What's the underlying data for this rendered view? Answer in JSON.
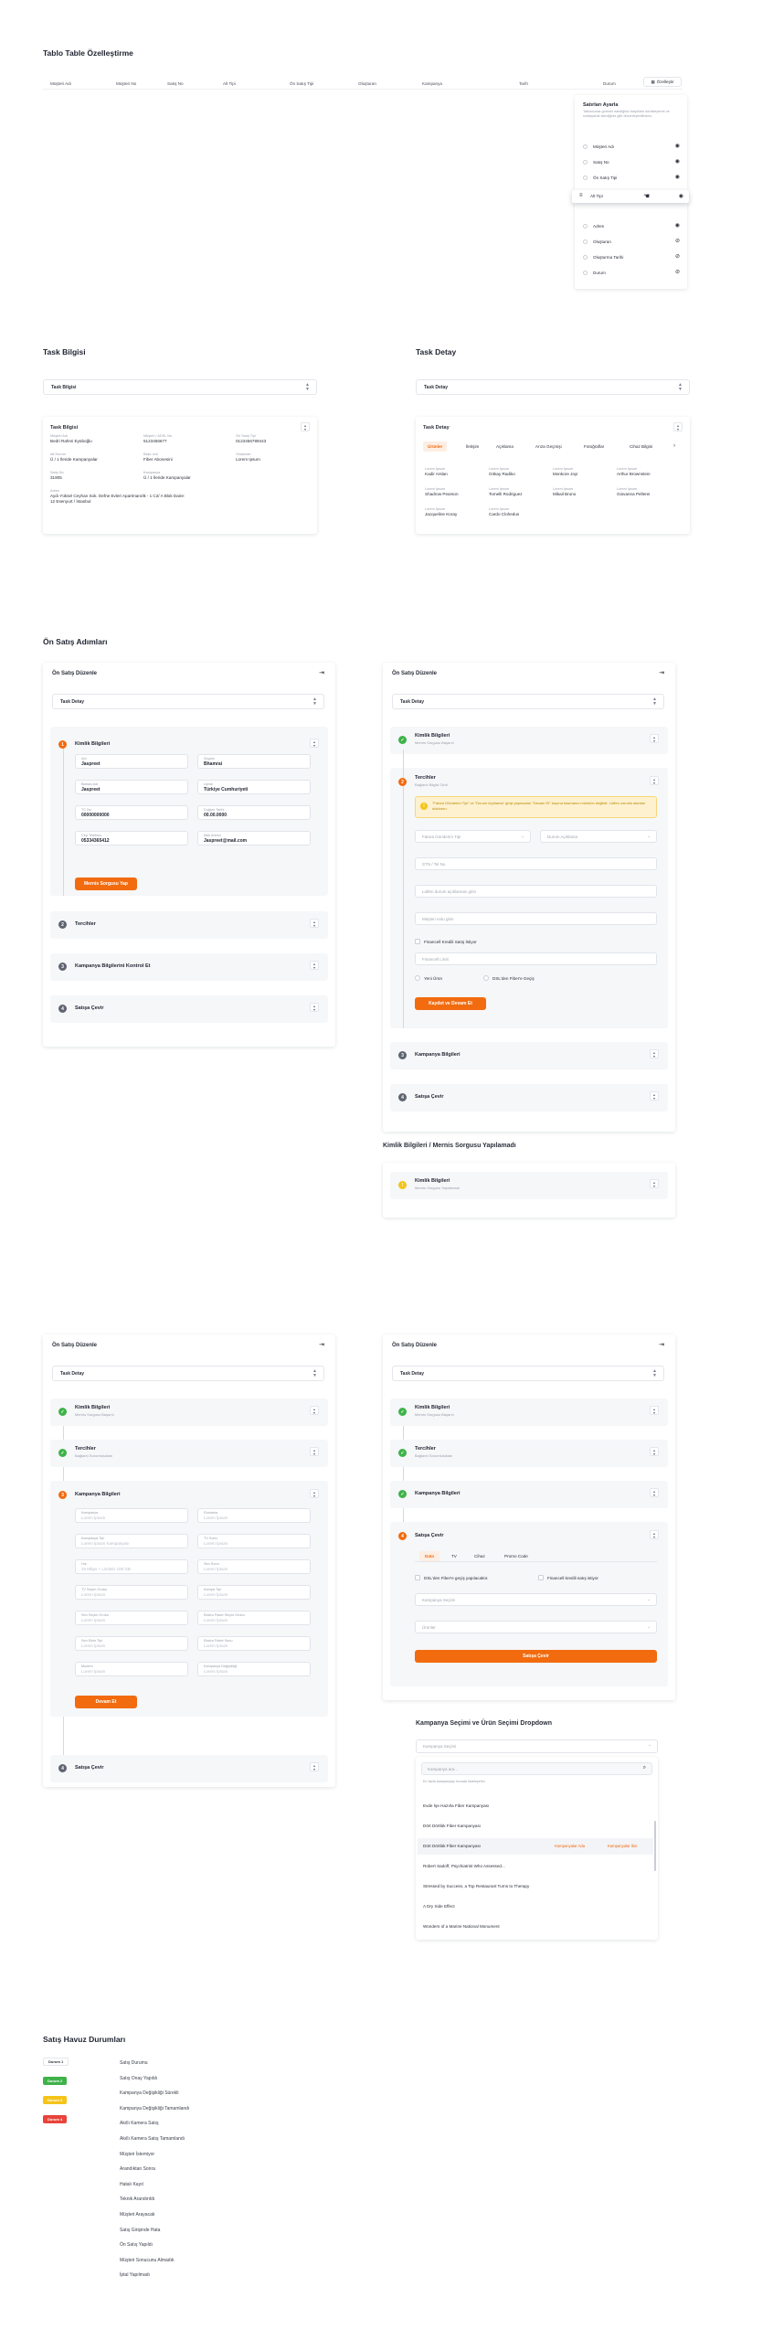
{
  "s1": {
    "title": "Tablo Table Özelleştirme",
    "columns": [
      "Müşteri Adı",
      "Müşteri No",
      "Satış No",
      "Alt Tipi",
      "Ön Satış Tipi",
      "Oluşturan",
      "Kampanya",
      "Tarih",
      "Durum"
    ],
    "customize_btn": "Özelleştir",
    "popup": {
      "title": "Satırları Ayarla",
      "desc": "Tablonuzda görmek istediğiniz başlıkları sürükleyerek ve sıralayarak istediğiniz gibi düzenleyebilirsiniz.",
      "rows": [
        "Müşteri Adı",
        "Satış No",
        "Ön Satış Tipi",
        "Müşteri No",
        "Adres",
        "Oluşturan",
        "Oluşturma Tarihi",
        "Durum"
      ],
      "dragging": "Alt Tipi"
    }
  },
  "s2": {
    "left_title": "Task Bilgisi",
    "right_title": "Task Detay",
    "left_select": "Task Bilgisi",
    "right_select": "Task Detay",
    "info_card_title": "Task Bilgisi",
    "info": [
      {
        "label": "Müşteri Adı",
        "value": "Bedri Rahmi Eyüboğlu"
      },
      {
        "label": "Müşteri / ADSL No",
        "value": "5123456677"
      },
      {
        "label": "Ön Satış Tipi",
        "value": "0123456789443"
      },
      {
        "label": "Alt Durum",
        "value": "Ü / 1 İleride Kampanyalar"
      },
      {
        "label": "Başv. Adı",
        "value": "Fiber Abonesini"
      },
      {
        "label": "Oluşturan",
        "value": "Lorem Ipsum"
      },
      {
        "label": "Satış No",
        "value": "31905"
      },
      {
        "label": "Kampanya",
        "value": "Ü / 1 İleride Kampanyalar"
      },
      {
        "label": "Adres",
        "value": "Aydı Yüksel Ceyhan Sok. Defne Evleri Apartmanı/B - 1 C2/ A Blok Daire: 12 Esenyurt / İstanbul"
      }
    ],
    "detail_card_title": "Task Detay",
    "tabs": [
      "Ürünler",
      "İletişim",
      "Açıklama",
      "Arıza Geçmişi",
      "Fotoğraflar",
      "Cihaz Bilgisi"
    ],
    "products": [
      {
        "l": "Lorem İpsum",
        "v": "Kadir Arslan"
      },
      {
        "l": "Lorem İpsum",
        "v": "Gökay Radiko"
      },
      {
        "l": "Lorem İpsum",
        "v": "Monkore Joyi"
      },
      {
        "l": "Lorem İpsum",
        "v": "Arthur Brownstein"
      },
      {
        "l": "Lorem İpsum",
        "v": "Shadrow Pearson"
      },
      {
        "l": "Lorem İpsum",
        "v": "Tomelli Rodriguez"
      },
      {
        "l": "Lorem İpsum",
        "v": "Mikail Bruno"
      },
      {
        "l": "Lorem İpsum",
        "v": "Giovanna Pellerei"
      },
      {
        "l": "Lorem İpsum",
        "v": "Jacqueline Koray"
      },
      {
        "l": "Lorem İpsum",
        "v": "Cardo Clohedus"
      }
    ]
  },
  "s3": {
    "title": "Ön Satış Adımları",
    "panel_title": "Ön Satış Düzenle",
    "task_select": "Task Detay",
    "step1": "Kimlik Bilgileri",
    "step1_sub": "Mernis Sorgusu Başarılı",
    "step1_sub_warn": "Mernis Sorgusu Yapılamadı",
    "step2": "Tercihler",
    "step2_sub": "Bağlantı Bilgisi Girdi",
    "step2_sub_done": "Bağlantı Sorumlulukları",
    "step3": "Kampanya Bilgilerini Kontrol Et",
    "step3b": "Kampanya Bilgileri",
    "step4": "Satışa Çevir",
    "identity": [
      {
        "l": "Adı",
        "v": "Jaspreet"
      },
      {
        "l": "Soyadı",
        "v": "Bhamrai"
      },
      {
        "l": "Babası Adı",
        "v": "Jaspreet"
      },
      {
        "l": "Uyruk",
        "v": "Türkiye Cumhuriyeti"
      },
      {
        "l": "TC No",
        "v": "00000000000"
      },
      {
        "l": "Doğum Tarihi",
        "v": "00.00.0000"
      },
      {
        "l": "Cep Telefonu",
        "v": "05334365412"
      },
      {
        "l": "Mail Adresi",
        "v": "Jaspreet@mail.com"
      }
    ],
    "mernis_btn": "Mernis Sorgusu Yap",
    "warn_text": "\"Fatura Gönderim Tipi\" ve \"Durum Açıklama\" girişi yapmadan \"Devam Et\" tuşuna basmanız mümkün değildir. Lütfen zorunlu alanları doldurun.",
    "invoice_type": "Fatura Gönderim Tipi",
    "status_desc": "Durum Açıklama",
    "inputs": [
      "STN / Tel No",
      "Lütfen durum açıklaması girin",
      "Müşteri notu girin"
    ],
    "credit_check": "Financell Kredili Satış İstiyor",
    "credit_limit": "Financell Limit",
    "radio1": "Yeni Ürün",
    "radio2": "DSL'den Fiber'e Geçiş",
    "save_btn": "Kaydet ve Devam Et",
    "warn_section_title": "Kimlik Bilgileri / Mernis Sorgusu Yapılamadı"
  },
  "s4": {
    "campaign_fields": [
      {
        "l": "Kampanya",
        "p": "Lorem İpsum"
      },
      {
        "l": "Runlama",
        "p": "Lorem İpsum"
      },
      {
        "l": "Kampanya Tipi",
        "p": "Lorem İpsum Kampanyası"
      },
      {
        "l": "TV Sonu",
        "p": "Lorem İpsum"
      },
      {
        "l": "Hız",
        "p": "16 Mbps + Limitsiz 100 GB"
      },
      {
        "l": "Sen Sonu",
        "p": "Lorem İpsum"
      },
      {
        "l": "TV Seçim Grubu",
        "p": "Lorem İpsum"
      },
      {
        "l": "Kampa Tipi",
        "p": "Lorem İpsum"
      },
      {
        "l": "Sen Seçim Grubu",
        "p": "Lorem İpsum"
      },
      {
        "l": "Ekstra Paket Seçim Grubu",
        "p": "Lorem İpsum"
      },
      {
        "l": "Sen Ekim Tipi",
        "p": "Lorem İpsum"
      },
      {
        "l": "Ekstra Paket Sonu",
        "p": "Lorem İpsum"
      },
      {
        "l": "Modem",
        "p": "Lorem İpsum"
      },
      {
        "l": "Kampanya Değişikliği",
        "p": "Lorem İpsum"
      }
    ],
    "continue_btn": "Devam Et",
    "sale_tabs": [
      "Data",
      "TV",
      "Cihaz",
      "Promo Code"
    ],
    "check1": "DSL'den Fiber'e geçiş yapılacaktır.",
    "check2": "Financell kredili satış istiyor",
    "campaign_select": "Kampanya Seçimi",
    "product_select": "Ürünler",
    "sale_btn": "Satışa Çevir",
    "dropdown_title": "Kampanya Seçimi ve Ürün Seçimi Dropdown",
    "search_placeholder": "Kampanya ara...",
    "search_hint": "En fazla kampanyayı burada listeleyelim",
    "options": [
      "Evde İşe Hazırla Fiber Kampanyası",
      "Dört Dörtlük Fiber Kampanyası",
      "Dört Dörtlük Fiber Kampanyası",
      "Robert Sadoff, Psychiatrist Who Assessed...",
      "Stressed by Success, a Top Restaurant Turns to Therapy",
      "A Dry Side Effect",
      "Wonders of a Marine National Monument"
    ],
    "hover_tag1": "Kampanyalar Ada",
    "hover_tag2": "Kampanyalar İkin"
  },
  "s5": {
    "title": "Satış Havuz Durumları",
    "badges": [
      {
        "label": "Durum 1",
        "color": "#ffffff",
        "text": "#2b2f3a"
      },
      {
        "label": "Durum 2",
        "color": "#3fb24a",
        "text": "#ffffff"
      },
      {
        "label": "Durum 3",
        "color": "#f5c419",
        "text": "#ffffff"
      },
      {
        "label": "Durum 4",
        "color": "#e9433b",
        "text": "#ffffff"
      }
    ],
    "statuses": [
      "Satış Durumu",
      "Satış Onay Yapıldı",
      "Kampanya Değişikliği Sürekli",
      "Kampanya Değişikliği Tamamlandı",
      "Akıllı Kamera Satış",
      "Akıllı Kamera Satış Tamamlandı",
      "Müşteri İstemiyor",
      "Arandıktan Sonra",
      "Hatalı Kayıt",
      "Teknik Arandırıldı",
      "Müşteri Arayacak",
      "Satış Girişinde Hata",
      "Ön Satış Yapıldı",
      "Müşteri Sonucunu Almadık",
      "İptal Yapılmadı"
    ]
  }
}
